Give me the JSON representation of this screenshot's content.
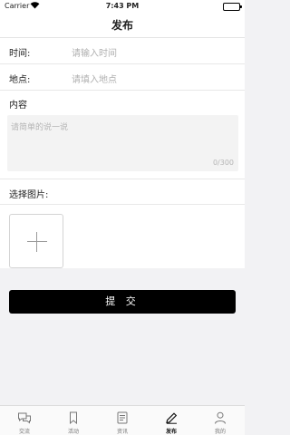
{
  "status_bar": {
    "carrier": "Carrier",
    "time": "7:43 PM"
  },
  "nav": {
    "title": "发布"
  },
  "form": {
    "time_label": "时间:",
    "time_placeholder": "请输入时间",
    "place_label": "地点:",
    "place_placeholder": "请填入地点",
    "content_label": "内容",
    "content_placeholder": "请简单的说一说",
    "char_counter": "0/300",
    "image_label": "选择图片:"
  },
  "submit": {
    "label": "提 交"
  },
  "tabs": [
    {
      "label": "交流",
      "icon": "chat-icon",
      "active": false
    },
    {
      "label": "活动",
      "icon": "bookmark-icon",
      "active": false
    },
    {
      "label": "资讯",
      "icon": "news-icon",
      "active": false
    },
    {
      "label": "发布",
      "icon": "pencil-icon",
      "active": true
    },
    {
      "label": "我的",
      "icon": "user-icon",
      "active": false
    }
  ]
}
